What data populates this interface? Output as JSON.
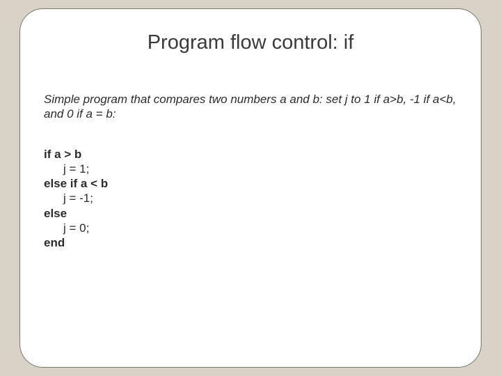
{
  "slide": {
    "title": "Program flow control: if",
    "description": "Simple program that compares two numbers a and b: set j to 1 if a>b, -1 if a<b, and 0 if a = b:",
    "code": {
      "line1_kw": "if a > b",
      "line2": "j = 1;",
      "line3_kw": "else if a < b",
      "line4": "j = -1;",
      "line5_kw": "else",
      "line6": "j = 0;",
      "line7_kw": "end"
    }
  }
}
